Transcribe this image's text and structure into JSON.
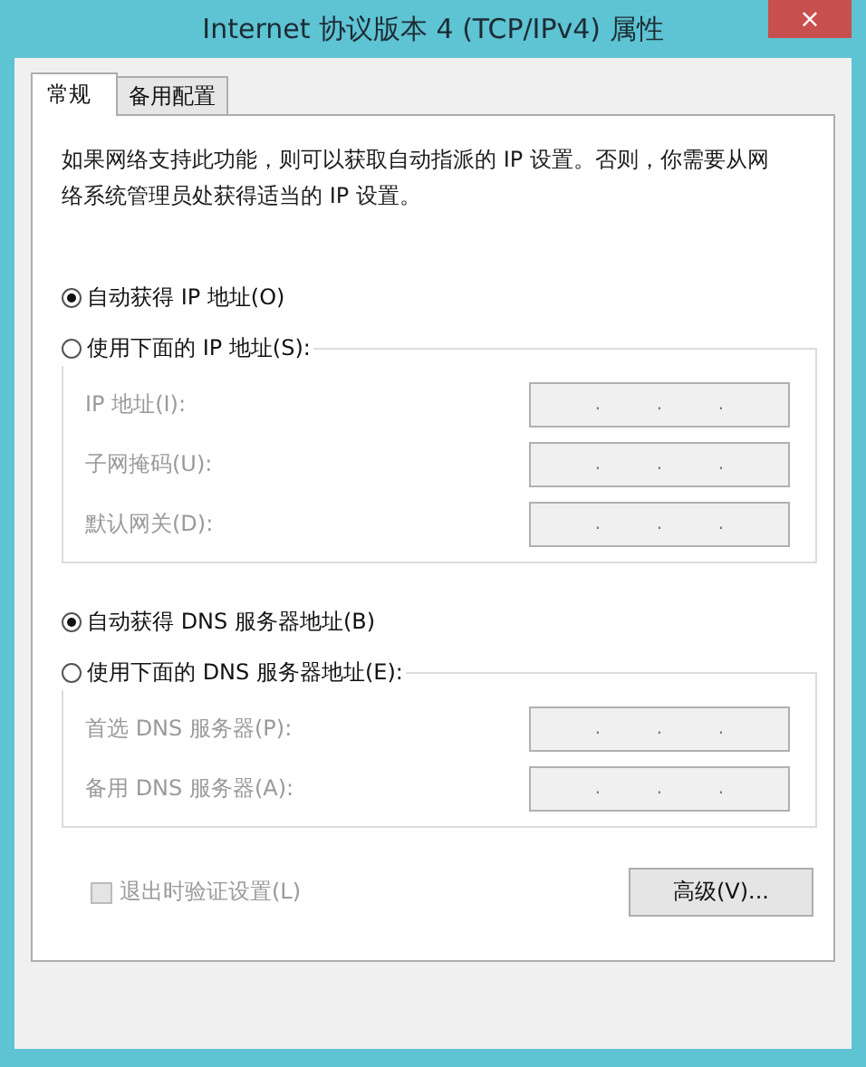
{
  "window": {
    "title": "Internet 协议版本 4 (TCP/IPv4) 属性",
    "close": "×"
  },
  "tabs": [
    {
      "label": "常规",
      "selected": true
    },
    {
      "label": "备用配置",
      "selected": false
    }
  ],
  "description": "如果网络支持此功能，则可以获取自动指派的 IP 设置。否则，你需要从网络系统管理员处获得适当的 IP 设置。",
  "ip_mode": [
    {
      "label": "自动获得 IP 地址(O)",
      "selected": true
    },
    {
      "label": "使用下面的 IP 地址(S):",
      "selected": false
    }
  ],
  "ip_fields": [
    {
      "label": "IP 地址(I):",
      "disabled": true,
      "dots": [
        ".",
        ".",
        "."
      ]
    },
    {
      "label": "子网掩码(U):",
      "disabled": true,
      "dots": [
        ".",
        ".",
        "."
      ]
    },
    {
      "label": "默认网关(D):",
      "disabled": true,
      "dots": [
        ".",
        ".",
        "."
      ]
    }
  ],
  "dns_mode": [
    {
      "label": "自动获得 DNS 服务器地址(B)",
      "selected": true
    },
    {
      "label": "使用下面的 DNS 服务器地址(E):",
      "selected": false
    }
  ],
  "dns_fields": [
    {
      "label": "首选 DNS 服务器(P):",
      "disabled": true,
      "dots": [
        ".",
        ".",
        "."
      ]
    },
    {
      "label": "备用 DNS 服务器(A):",
      "disabled": true,
      "dots": [
        ".",
        ".",
        "."
      ]
    }
  ],
  "validate_checkbox": {
    "label": "退出时验证设置(L)",
    "checked": false,
    "disabled": true
  },
  "advanced_button": "高级(V)..."
}
